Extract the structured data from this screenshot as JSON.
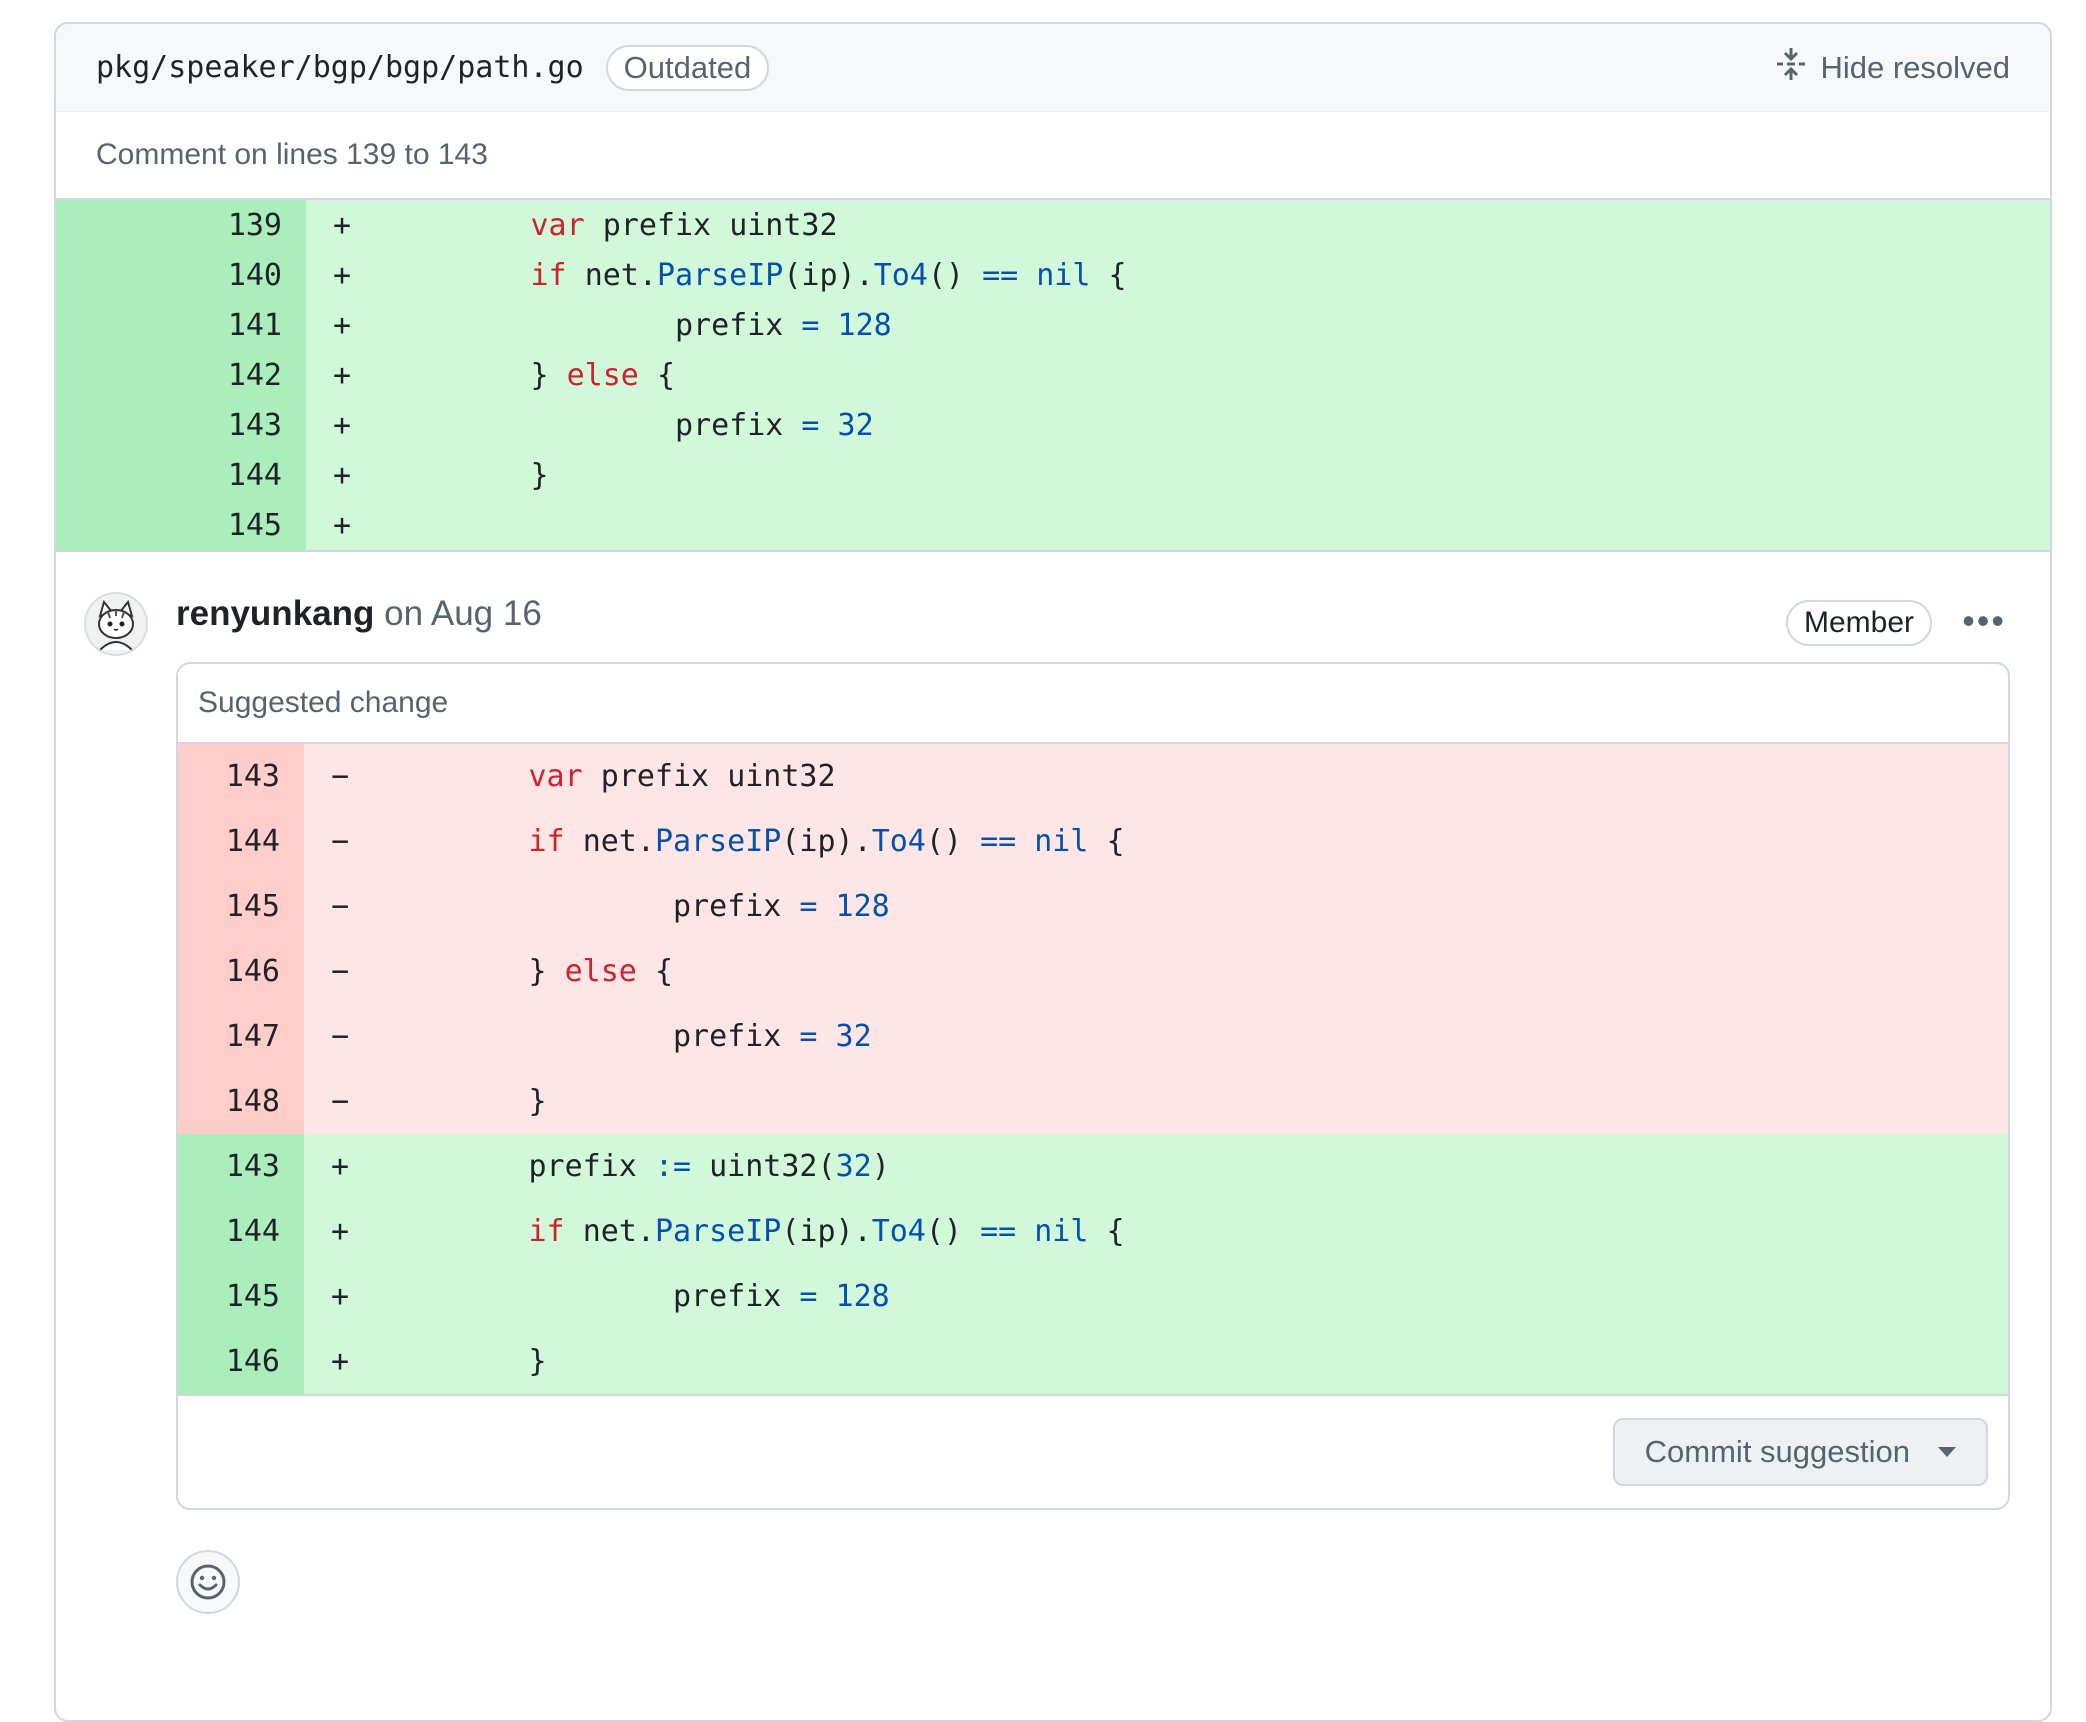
{
  "file": {
    "path": "pkg/speaker/bgp/bgp/path.go",
    "status_badge": "Outdated",
    "hide_resolved_label": "Hide resolved"
  },
  "comment_range": "Comment on lines 139 to 143",
  "context_diff": [
    {
      "num": "139",
      "sign": "+",
      "type": "add"
    },
    {
      "num": "140",
      "sign": "+",
      "type": "add"
    },
    {
      "num": "141",
      "sign": "+",
      "type": "add"
    },
    {
      "num": "142",
      "sign": "+",
      "type": "add"
    },
    {
      "num": "143",
      "sign": "+",
      "type": "add"
    },
    {
      "num": "144",
      "sign": "+",
      "type": "add"
    },
    {
      "num": "145",
      "sign": "+",
      "type": "add"
    }
  ],
  "comment": {
    "author": "renyunkang",
    "date": "on Aug 16",
    "role_badge": "Member",
    "suggestion_title": "Suggested change",
    "commit_button": "Commit suggestion"
  },
  "suggestion_diff": [
    {
      "num": "143",
      "sign": "−",
      "type": "del"
    },
    {
      "num": "144",
      "sign": "−",
      "type": "del"
    },
    {
      "num": "145",
      "sign": "−",
      "type": "del"
    },
    {
      "num": "146",
      "sign": "−",
      "type": "del"
    },
    {
      "num": "147",
      "sign": "−",
      "type": "del"
    },
    {
      "num": "148",
      "sign": "−",
      "type": "del"
    },
    {
      "num": "143",
      "sign": "+",
      "type": "add"
    },
    {
      "num": "144",
      "sign": "+",
      "type": "add"
    },
    {
      "num": "145",
      "sign": "+",
      "type": "add"
    },
    {
      "num": "146",
      "sign": "+",
      "type": "add"
    }
  ],
  "code_tokens": {
    "var": "var",
    "prefix": "prefix",
    "uint32": "uint32",
    "if": "if",
    "net": "net.",
    "ParseIP": "ParseIP",
    "ip": "(ip).",
    "To4": "To4",
    "parens": "()",
    "eqeq": "==",
    "nil": "nil",
    "lbrace": "{",
    "rbrace": "}",
    "eq": "=",
    "n128": "128",
    "n32": "32",
    "else": "else",
    "assign": ":=",
    "uint32call": "uint32(",
    "rparen": ")"
  },
  "icons": {
    "hide_resolved": "fold-icon",
    "avatar": "cat-avatar",
    "more": "kebab-horizontal-icon",
    "dropdown": "triangle-down-icon",
    "reaction": "smiley-icon"
  },
  "colors": {
    "add_bg": "#d1f8d9",
    "add_num_bg": "#aceebb",
    "del_bg": "#ffe6e6",
    "del_num_bg": "#ffcecb",
    "keyword": "#cf222e",
    "entity": "#0550ae"
  }
}
